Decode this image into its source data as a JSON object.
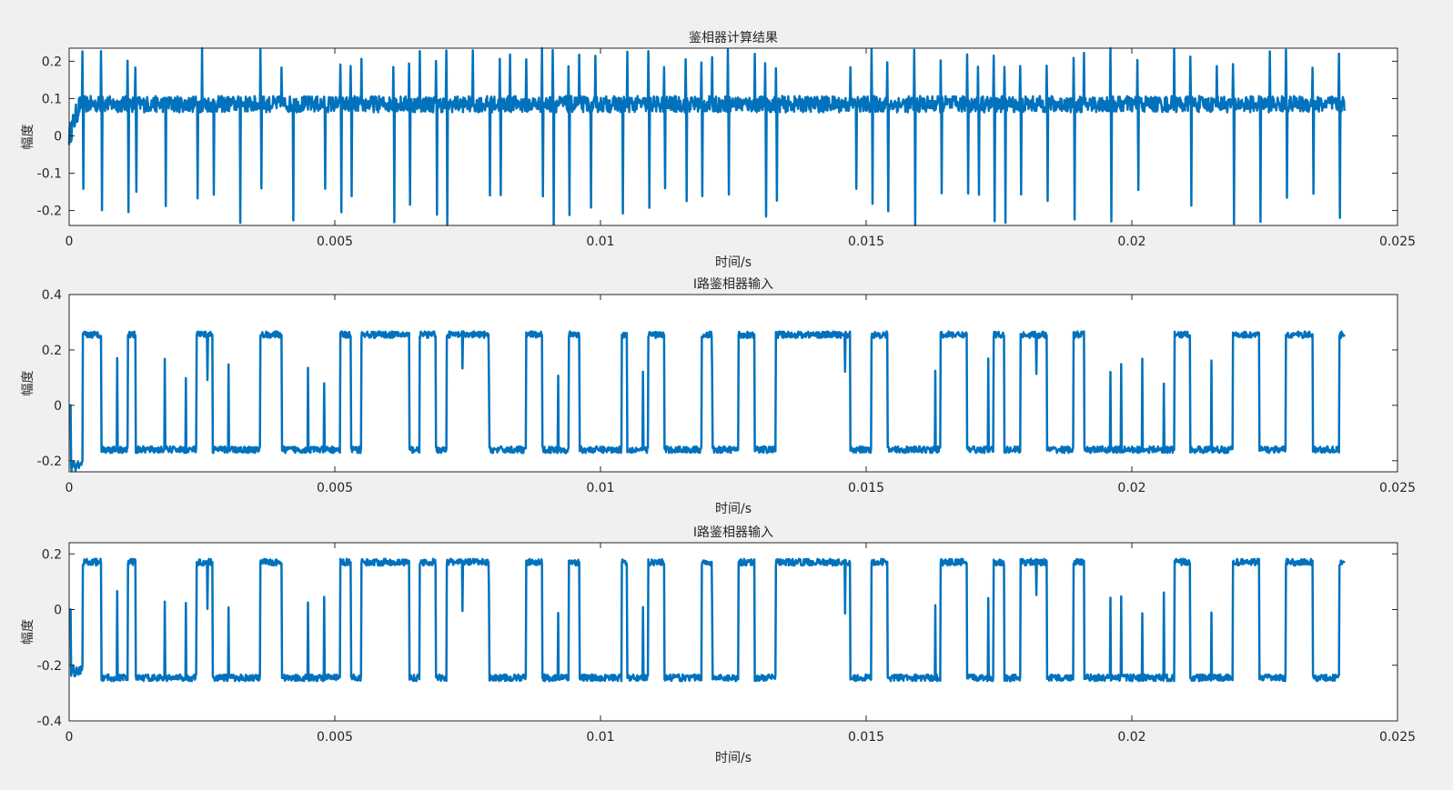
{
  "figure": {
    "background": "#f0f0f0",
    "axes_background": "#ffffff",
    "axis_color": "#262626",
    "line_color": "#0072bd"
  },
  "chart_data": [
    {
      "type": "line",
      "title": "鉴相器计算结果",
      "xlabel": "时间/s",
      "ylabel": "幅度",
      "xlim": [
        0,
        0.025
      ],
      "ylim": [
        -0.24,
        0.235
      ],
      "xticks": [
        0,
        0.005,
        0.01,
        0.015,
        0.02,
        0.025
      ],
      "xtick_labels": [
        "0",
        "0.005",
        "0.01",
        "0.015",
        "0.02",
        "0.025"
      ],
      "yticks": [
        -0.2,
        -0.1,
        0,
        0.1,
        0.2
      ],
      "ytick_labels": [
        "-0.2",
        "-0.1",
        "0",
        "0.1",
        "0.2"
      ],
      "grid": false,
      "series": [
        {
          "baseline": 0.085,
          "noise": 0.022,
          "start_value": 0.0,
          "x_end": 0.024,
          "spikes_up": [
            0.00025,
            0.0006,
            0.0011,
            0.00125,
            0.0025,
            0.0036,
            0.004,
            0.0051,
            0.0053,
            0.0055,
            0.0061,
            0.0064,
            0.0066,
            0.0069,
            0.0071,
            0.0076,
            0.0081,
            0.0083,
            0.0086,
            0.0089,
            0.0091,
            0.0094,
            0.0096,
            0.0099,
            0.0105,
            0.0109,
            0.0112,
            0.0116,
            0.0119,
            0.0121,
            0.0124,
            0.0129,
            0.0131,
            0.0133,
            0.0147,
            0.0151,
            0.0154,
            0.0159,
            0.0164,
            0.0169,
            0.0171,
            0.0174,
            0.0176,
            0.0179,
            0.0184,
            0.0189,
            0.0191,
            0.0196,
            0.0201,
            0.0208,
            0.0211,
            0.0216,
            0.0219,
            0.0226,
            0.0229,
            0.0234,
            0.0239
          ],
          "spikes_down": [
            0.00025,
            0.0006,
            0.0011,
            0.00125,
            0.0018,
            0.0024,
            0.0027,
            0.0032,
            0.0036,
            0.0042,
            0.0048,
            0.0051,
            0.0053,
            0.0061,
            0.0064,
            0.0069,
            0.0071,
            0.0079,
            0.0081,
            0.0089,
            0.0091,
            0.0094,
            0.0098,
            0.0104,
            0.0109,
            0.0112,
            0.0116,
            0.0119,
            0.0124,
            0.0131,
            0.0133,
            0.0148,
            0.0151,
            0.0154,
            0.0159,
            0.0164,
            0.0169,
            0.0171,
            0.0174,
            0.0176,
            0.0179,
            0.0184,
            0.0189,
            0.0196,
            0.0201,
            0.0211,
            0.0219,
            0.0224,
            0.0229,
            0.0234,
            0.0239
          ]
        }
      ]
    },
    {
      "type": "line",
      "title": "I路鉴相器输入",
      "xlabel": "时间/s",
      "ylabel": "幅度",
      "xlim": [
        0,
        0.025
      ],
      "ylim": [
        -0.24,
        0.4
      ],
      "xticks": [
        0,
        0.005,
        0.01,
        0.015,
        0.02,
        0.025
      ],
      "xtick_labels": [
        "0",
        "0.005",
        "0.01",
        "0.015",
        "0.02",
        "0.025"
      ],
      "yticks": [
        -0.2,
        0,
        0.2,
        0.4
      ],
      "ytick_labels": [
        "-0.2",
        "0",
        "0.2",
        "0.4"
      ],
      "grid": false,
      "series": [
        {
          "high": 0.255,
          "low": -0.16,
          "noise": 0.012,
          "start_value": 0.0,
          "start_dip": -0.22,
          "x_end": 0.024,
          "high_intervals": [
            [
              0.00025,
              0.0006
            ],
            [
              0.0011,
              0.00125
            ],
            [
              0.0024,
              0.0027
            ],
            [
              0.0036,
              0.004
            ],
            [
              0.0051,
              0.0053
            ],
            [
              0.0055,
              0.0064
            ],
            [
              0.0066,
              0.0069
            ],
            [
              0.0071,
              0.0079
            ],
            [
              0.0086,
              0.0089
            ],
            [
              0.0094,
              0.0096
            ],
            [
              0.0104,
              0.0105
            ],
            [
              0.0109,
              0.0112
            ],
            [
              0.0119,
              0.0121
            ],
            [
              0.0126,
              0.0129
            ],
            [
              0.0133,
              0.0147
            ],
            [
              0.0151,
              0.0154
            ],
            [
              0.0164,
              0.0169
            ],
            [
              0.0174,
              0.0176
            ],
            [
              0.0179,
              0.0184
            ],
            [
              0.0189,
              0.0191
            ],
            [
              0.0208,
              0.0211
            ],
            [
              0.0219,
              0.0224
            ],
            [
              0.0229,
              0.0234
            ],
            [
              0.0239,
              0.024
            ]
          ],
          "spikes": [
            0.0009,
            0.0018,
            0.0022,
            0.0026,
            0.003,
            0.0045,
            0.0048,
            0.0074,
            0.0079,
            0.0092,
            0.0108,
            0.0121,
            0.0146,
            0.0163,
            0.0173,
            0.0182,
            0.0196,
            0.0198,
            0.0202,
            0.0206,
            0.0215
          ]
        }
      ]
    },
    {
      "type": "line",
      "title": "I路鉴相器输入",
      "xlabel": "时间/s",
      "ylabel": "幅度",
      "xlim": [
        0,
        0.025
      ],
      "ylim": [
        -0.4,
        0.24
      ],
      "xticks": [
        0,
        0.005,
        0.01,
        0.015,
        0.02,
        0.025
      ],
      "xtick_labels": [
        "0",
        "0.005",
        "0.01",
        "0.015",
        "0.02",
        "0.025"
      ],
      "yticks": [
        -0.4,
        -0.2,
        0,
        0.2
      ],
      "ytick_labels": [
        "-0.4",
        "-0.2",
        "0",
        "0.2"
      ],
      "grid": false,
      "series": [
        {
          "high": 0.17,
          "low": -0.245,
          "noise": 0.012,
          "start_value": 0.0,
          "start_dip": -0.22,
          "x_end": 0.024,
          "high_intervals": [
            [
              0.00025,
              0.0006
            ],
            [
              0.0011,
              0.00125
            ],
            [
              0.0024,
              0.0027
            ],
            [
              0.0036,
              0.004
            ],
            [
              0.0051,
              0.0053
            ],
            [
              0.0055,
              0.0064
            ],
            [
              0.0066,
              0.0069
            ],
            [
              0.0071,
              0.0079
            ],
            [
              0.0086,
              0.0089
            ],
            [
              0.0094,
              0.0096
            ],
            [
              0.0104,
              0.0105
            ],
            [
              0.0109,
              0.0112
            ],
            [
              0.0119,
              0.0121
            ],
            [
              0.0126,
              0.0129
            ],
            [
              0.0133,
              0.0147
            ],
            [
              0.0151,
              0.0154
            ],
            [
              0.0164,
              0.0169
            ],
            [
              0.0174,
              0.0176
            ],
            [
              0.0179,
              0.0184
            ],
            [
              0.0189,
              0.0191
            ],
            [
              0.0208,
              0.0211
            ],
            [
              0.0219,
              0.0224
            ],
            [
              0.0229,
              0.0234
            ],
            [
              0.0239,
              0.024
            ]
          ],
          "spikes": [
            0.0009,
            0.0018,
            0.0022,
            0.0026,
            0.003,
            0.0045,
            0.0048,
            0.0074,
            0.0079,
            0.0092,
            0.0108,
            0.0121,
            0.0146,
            0.0163,
            0.0173,
            0.0182,
            0.0196,
            0.0198,
            0.0202,
            0.0206,
            0.0215
          ]
        }
      ]
    }
  ]
}
